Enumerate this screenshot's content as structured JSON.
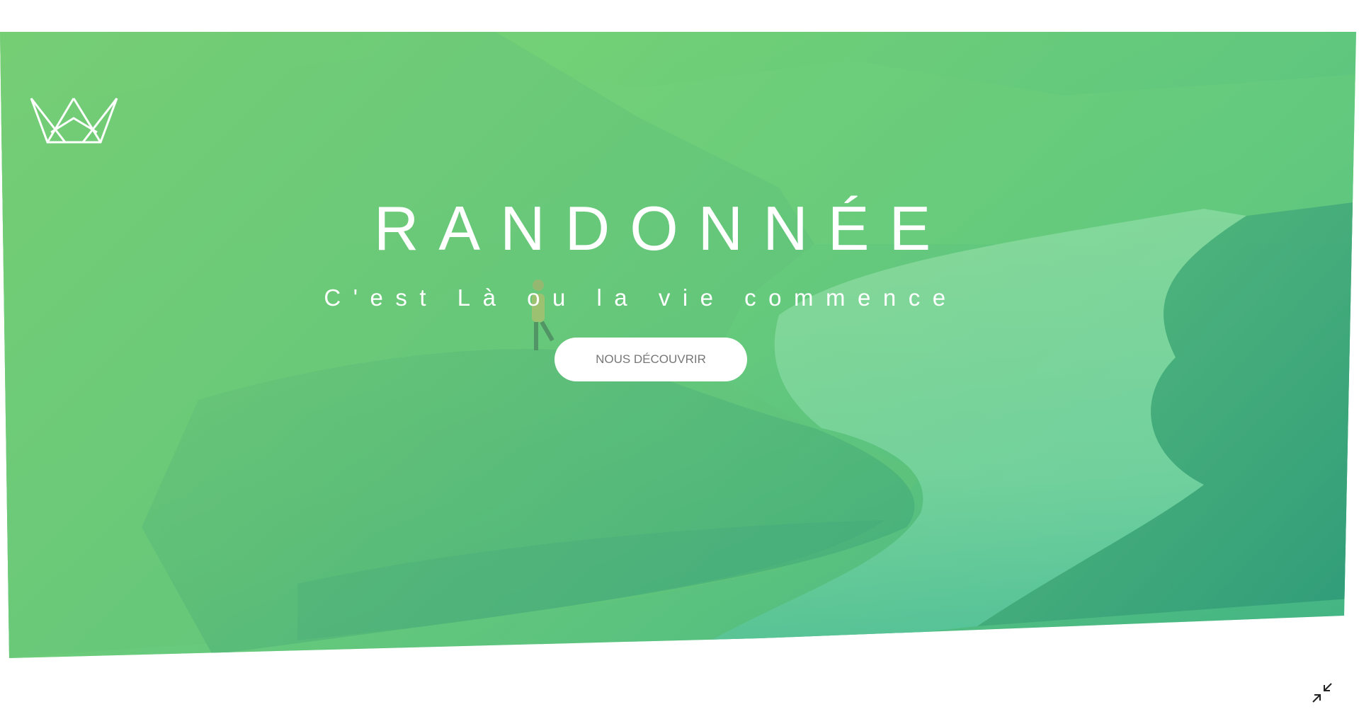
{
  "hero": {
    "title": "RANDONNÉE",
    "subtitle": "C'est Là ou la vie commence",
    "cta_label": "NOUS DÉCOUVRIR",
    "logo_icon": "crown-icon",
    "background": "mountain-fjord-photo"
  },
  "controls": {
    "collapse_icon": "collapse-arrows-icon"
  },
  "colors": {
    "gradient_start": "#7ed56f",
    "gradient_end": "#28b485",
    "button_bg": "#ffffff",
    "button_text": "#777777",
    "title_text": "#ffffff"
  }
}
